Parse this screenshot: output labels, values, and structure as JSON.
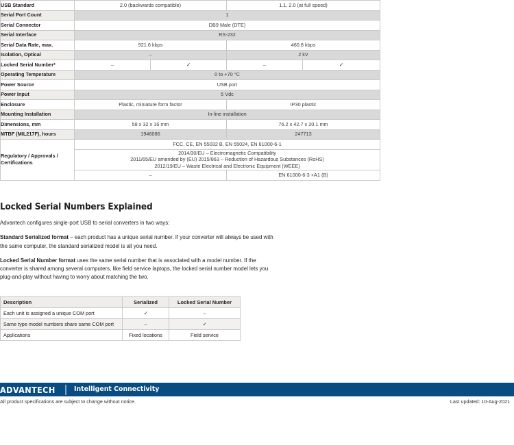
{
  "spec_table": {
    "rows": [
      {
        "label": "USB Standard",
        "cells": [
          {
            "text": "2.0 (backwards compatible)",
            "span": 2
          },
          {
            "text": "1.1, 2.0 (at full speed)",
            "span": 2
          }
        ],
        "shaded": false
      },
      {
        "label": "Serial Port Count",
        "cells": [
          {
            "text": "1",
            "span": 4
          }
        ],
        "shaded": true
      },
      {
        "label": "Serial Connector",
        "cells": [
          {
            "text": "DB9 Male (DTE)",
            "span": 4
          }
        ],
        "shaded": false
      },
      {
        "label": "Serial Interface",
        "cells": [
          {
            "text": "RS-232",
            "span": 4
          }
        ],
        "shaded": true
      },
      {
        "label": "Serial Data Rate, max.",
        "cells": [
          {
            "text": "921.6 kbps",
            "span": 2
          },
          {
            "text": "460.8 kbps",
            "span": 2
          }
        ],
        "shaded": false
      },
      {
        "label": "Isolation, Optical",
        "cells": [
          {
            "text": "–",
            "span": 2
          },
          {
            "text": "2 kV",
            "span": 2
          }
        ],
        "shaded": true
      },
      {
        "label": "Locked Serial Number*",
        "cells": [
          {
            "text": "–",
            "span": 1
          },
          {
            "text": "✓",
            "span": 1
          },
          {
            "text": "–",
            "span": 1
          },
          {
            "text": "✓",
            "span": 1
          }
        ],
        "shaded": false
      },
      {
        "label": "Operating Temperature",
        "cells": [
          {
            "text": "0 to +70 °C",
            "span": 4
          }
        ],
        "shaded": true
      },
      {
        "label": "Power Source",
        "cells": [
          {
            "text": "USB port",
            "span": 4
          }
        ],
        "shaded": false
      },
      {
        "label": "Power Input",
        "cells": [
          {
            "text": "5 Vdc",
            "span": 4
          }
        ],
        "shaded": true
      },
      {
        "label": "Enclosure",
        "cells": [
          {
            "text": "Plastic, miniature form factor",
            "span": 2
          },
          {
            "text": "IP30 plastic",
            "span": 2
          }
        ],
        "shaded": false
      },
      {
        "label": "Mounting Installation",
        "cells": [
          {
            "text": "In-line installation",
            "span": 4
          }
        ],
        "shaded": true
      },
      {
        "label": "Dimensions, mm",
        "cells": [
          {
            "text": "58 x 32 x 16 mm",
            "span": 2
          },
          {
            "text": "76.2 x 42.7 x 20.1 mm",
            "span": 2
          }
        ],
        "shaded": false
      },
      {
        "label": "MTBF (MIL217F), hours",
        "cells": [
          {
            "text": "1946086",
            "span": 2
          },
          {
            "text": "247713",
            "span": 2
          }
        ],
        "shaded": true
      }
    ],
    "regulatory": {
      "label_line1": "Regulatory / Approvals /",
      "label_line2": "Certifications",
      "row1": "FCC, CE, EN 55032 B, EN 55024, EN 61000-6-1",
      "row2_lines": [
        "2014/30/EU – Electromagnetic Compatibility",
        "2011/65/EU amended by (EU) 2015/863 – Reduction of Hazardous Substances (RoHS)",
        "2012/19/EU – Waste Electrical and Electronic Equipment (WEEE)"
      ],
      "row3_left": "–",
      "row3_right": "EN 61000-6-3 +A1 (B)"
    }
  },
  "section": {
    "heading": "Locked Serial Numbers Explained",
    "intro": "Advantech configures single-port USB to serial converters in two ways:",
    "para1_bold": "Standard Serialized format",
    "para1_rest": " – each product has a unique serial number. If your converter will always be used with the same computer, the standard serialized model is all you need.",
    "para2_bold": "Locked Serial Number format",
    "para2_rest": " uses the same serial number that is associated with a model number. If the converter is shared among several computers, like field service laptops, the locked serial number model lets you plug-and-play without having to worry about matching the two."
  },
  "comparison_table": {
    "headers": [
      "Description",
      "Serialized",
      "Locked Serial Number"
    ],
    "rows": [
      {
        "description": "Each unit is assigned a unique COM port",
        "serialized": "✓",
        "locked": "–"
      },
      {
        "description": "Same type model numbers share same COM port",
        "serialized": "–",
        "locked": "✓"
      },
      {
        "description": "Applications",
        "serialized": "Fixed locations",
        "locked": "Field service"
      }
    ]
  },
  "footer": {
    "logo": "ADVANTECH",
    "tagline": "Intelligent Connectivity",
    "note": "All product specifications are subject to change without notice.",
    "updated": "Last updated: 10-Aug-2021"
  },
  "colors": {
    "brand_blue": "#094c82",
    "row_shade": "#d9d9d9",
    "label_shade": "#efedea",
    "border": "#c9c9c9",
    "text": "#231f20"
  }
}
